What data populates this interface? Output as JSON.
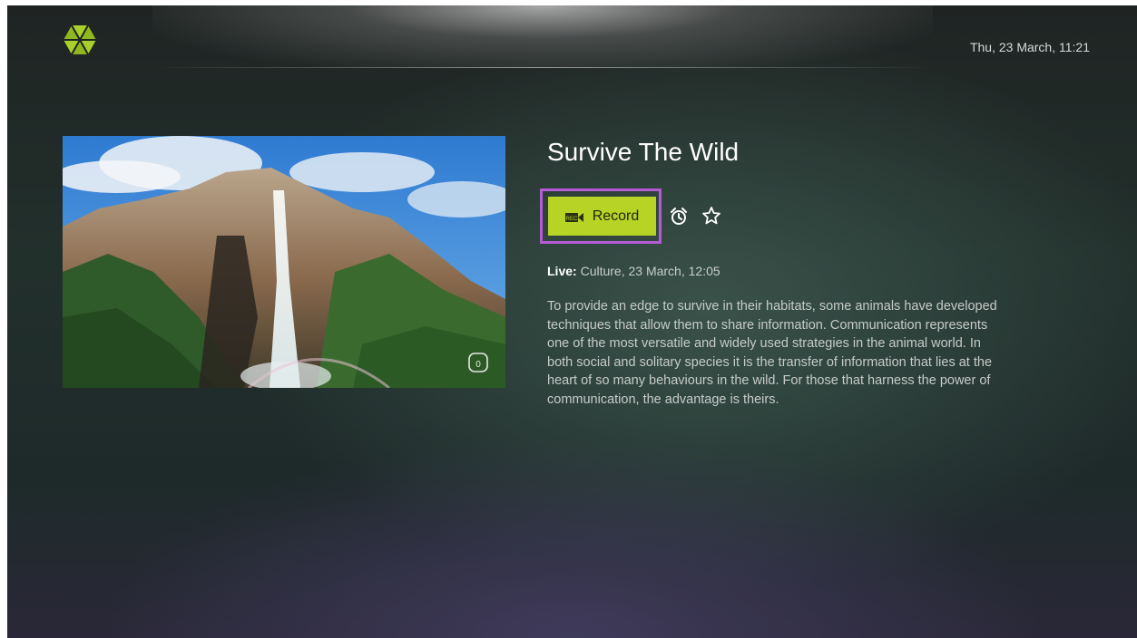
{
  "header": {
    "logo_icon": "channel-logo-icon",
    "datetime": "Thu, 23 March, 11:21"
  },
  "program": {
    "poster_icon": "waterfall-landscape-image",
    "rating_icon": "age-rating-icon",
    "title": "Survive The Wild",
    "actions": {
      "record_label": "Record",
      "record_icon": "rec-camera-icon",
      "reminder_icon": "alarm-clock-icon",
      "favorite_icon": "star-icon"
    },
    "live_label": "Live:",
    "live_info": " Culture, 23 March, 12:05",
    "description": "To provide an edge to survive in their habitats, some animals have developed techniques that allow them to share information. Communication represents one of the most versatile and widely used strategies in the animal world. In both social and solitary species it is the transfer of information that lies at the heart of so many behaviours in the wild. For those that harness the power of communication, the advantage is theirs."
  },
  "colors": {
    "accent": "#b7d325",
    "focus": "#b55bd6",
    "text": "#ffffff"
  }
}
